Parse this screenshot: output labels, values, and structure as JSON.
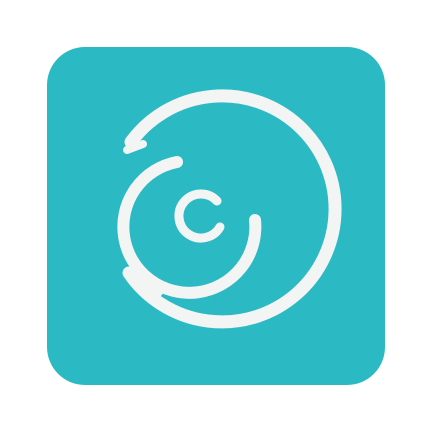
{
  "app_icon": {
    "icon": "swirl-c-logo-icon",
    "background_color": "#2bbac3",
    "stroke_color": "#f3f4f4"
  }
}
